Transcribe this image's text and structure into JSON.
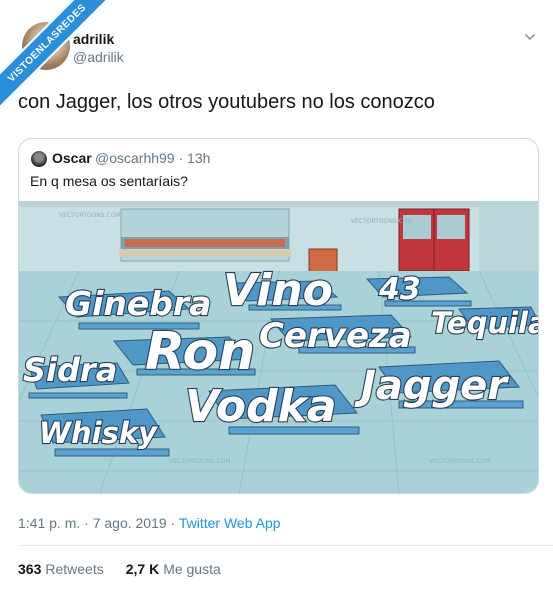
{
  "watermark": "VISTOENLASREDES",
  "author": {
    "name": "adrilik",
    "handle": "@adrilik"
  },
  "tweet": {
    "text": "con Jagger, los otros youtubers no los conozco"
  },
  "quoted": {
    "name": "Oscar",
    "handle_time": "@oscarhh99 · 13h",
    "text": "En q mesa os sentaríais?",
    "image_labels": {
      "ginebra": "Ginebra",
      "vino": "Vino",
      "n43": "43",
      "cerveza": "Cerveza",
      "tequila": "Tequila",
      "ron": "Ron",
      "sidra": "Sidra",
      "jagger": "Jagger",
      "vodka": "Vodka",
      "whisky": "Whisky"
    },
    "image_watermarks": [
      "VECTORTOONS.COM",
      "VECTORTOONS.COM",
      "VECTORTOONS.COM",
      "VECTORTOONS.COM"
    ]
  },
  "meta": {
    "time_date": "1:41 p. m. · 7 ago. 2019 · ",
    "app": "Twitter Web App"
  },
  "stats": {
    "retweets_count": "363",
    "retweets_label": "Retweets",
    "likes_count": "2,7 K",
    "likes_label": "Me gusta"
  },
  "colors": {
    "accent": "#1b95e0",
    "ribbon": "#2a8fd8",
    "floor": "#a9d2d8",
    "table": "#4f97c6"
  },
  "icons": {
    "caret": "chevron-down-icon"
  }
}
